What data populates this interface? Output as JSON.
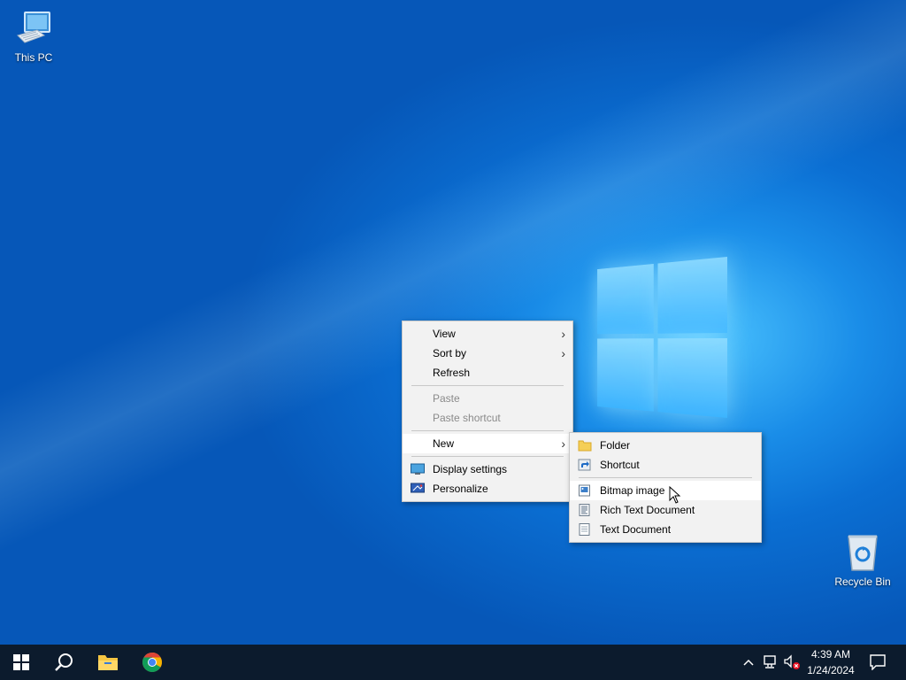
{
  "desktop": {
    "icons": [
      {
        "label": "This PC",
        "icon": "computer-icon"
      },
      {
        "label": "Recycle Bin",
        "icon": "recycle-bin-icon"
      }
    ]
  },
  "context_menu": {
    "items": [
      {
        "label": "View",
        "submenu": true,
        "enabled": true
      },
      {
        "label": "Sort by",
        "submenu": true,
        "enabled": true
      },
      {
        "label": "Refresh",
        "submenu": false,
        "enabled": true
      },
      {
        "label": "Paste",
        "submenu": false,
        "enabled": false
      },
      {
        "label": "Paste shortcut",
        "submenu": false,
        "enabled": false
      },
      {
        "label": "New",
        "submenu": true,
        "enabled": true,
        "highlighted": true
      },
      {
        "label": "Display settings",
        "icon": "display-settings-icon",
        "enabled": true
      },
      {
        "label": "Personalize",
        "icon": "personalize-icon",
        "enabled": true
      }
    ]
  },
  "new_submenu": {
    "items": [
      {
        "label": "Folder",
        "icon": "folder-icon"
      },
      {
        "label": "Shortcut",
        "icon": "shortcut-icon"
      },
      {
        "label": "Bitmap image",
        "icon": "bitmap-icon",
        "highlighted": true
      },
      {
        "label": "Rich Text Document",
        "icon": "rich-text-icon"
      },
      {
        "label": "Text Document",
        "icon": "text-document-icon"
      }
    ]
  },
  "taskbar": {
    "pinned": [
      "start-icon",
      "search-icon",
      "file-explorer-icon",
      "chrome-icon"
    ],
    "tray": [
      "show-hidden-icons",
      "network-icon",
      "volume-muted-icon"
    ],
    "time": "4:39 AM",
    "date": "1/24/2024"
  },
  "colors": {
    "taskbar": "#0c1b2d",
    "menu_bg": "#f2f2f2",
    "desktop_blue": "#0b6fd3"
  }
}
